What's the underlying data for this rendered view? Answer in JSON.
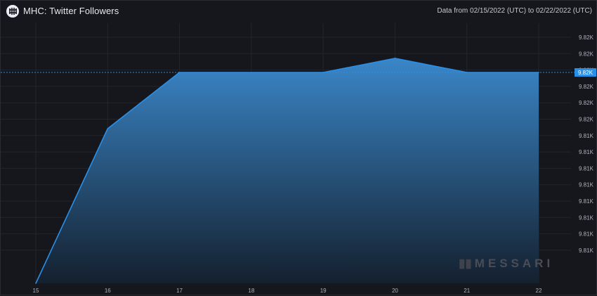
{
  "header": {
    "logo_icon": "messari-m-icon",
    "title": "MHC: Twitter Followers",
    "date_range": "Data from 02/15/2022 (UTC) to 02/22/2022 (UTC)"
  },
  "watermark": {
    "text": "MESSARI"
  },
  "chart_data": {
    "type": "area",
    "title": "MHC: Twitter Followers",
    "x": [
      "15",
      "16",
      "17",
      "18",
      "19",
      "20",
      "21",
      "22"
    ],
    "values": [
      9805,
      9816,
      9820,
      9820,
      9820,
      9821,
      9820,
      9820
    ],
    "y_tick_labels": [
      "9.82K",
      "9.82K",
      "9.82K",
      "9.82K",
      "9.82K",
      "9.82K",
      "9.81K",
      "9.81K",
      "9.81K",
      "9.81K",
      "9.81K",
      "9.81K",
      "9.81K",
      "9.81K"
    ],
    "ylim": [
      9805,
      9822.5
    ],
    "current_value_label": "9.82K",
    "grid": true,
    "colors": {
      "line": "#2a8fe6",
      "fill_top": "#3a86c8",
      "fill_bottom": "#14202e",
      "badge": "#2a8fe6"
    }
  }
}
